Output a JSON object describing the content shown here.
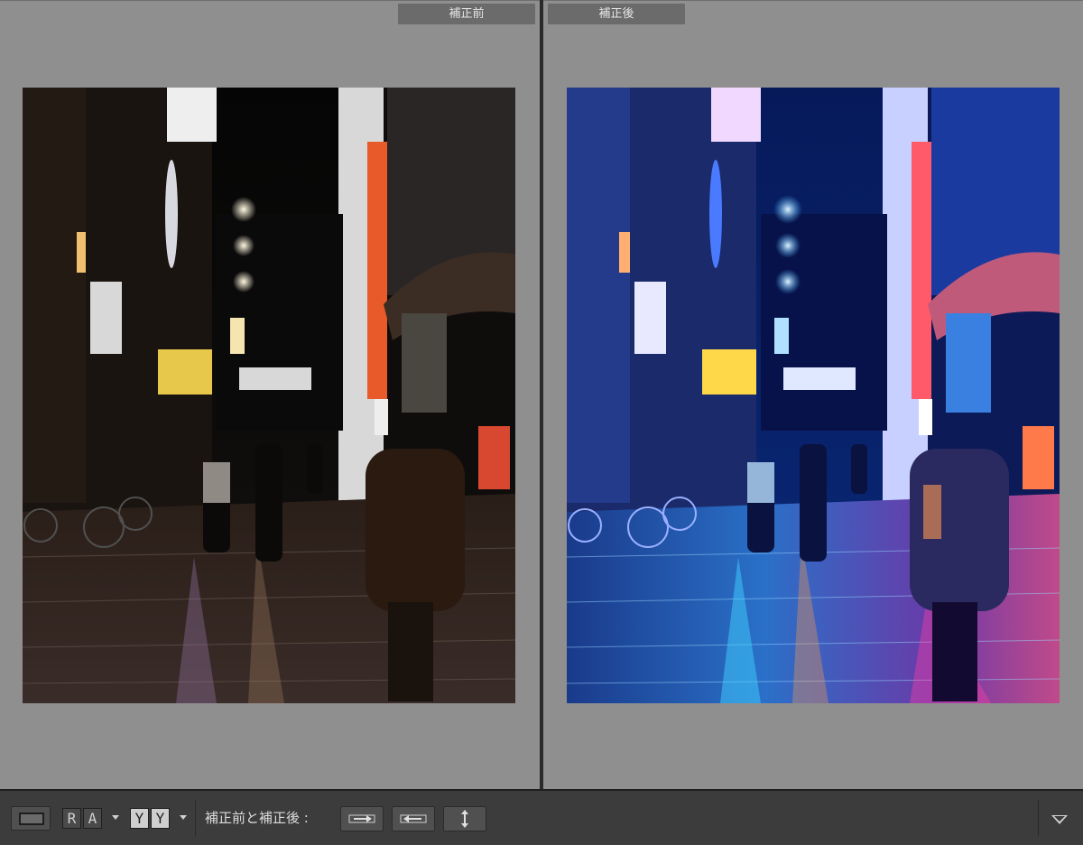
{
  "panes": {
    "before_label": "補正前",
    "after_label": "補正後"
  },
  "toolbar": {
    "loupe_icon": "single-view-icon",
    "split_lr": [
      "R",
      "A"
    ],
    "split_tb": [
      "Y",
      "Y"
    ],
    "compare_label": "補正前と補正後 :",
    "copy_before_to_after": "arrow-right-icon",
    "copy_after_to_before": "arrow-left-icon",
    "swap": "swap-vertical-icon",
    "panel_toggle": "triangle-down-icon"
  },
  "colors": {
    "before_tint": "#1a1208",
    "after_tint": "#0a2a7a",
    "neon_pink": "#ff3fa8",
    "neon_cyan": "#3fd0ff",
    "neon_orange": "#ff7a2a"
  }
}
